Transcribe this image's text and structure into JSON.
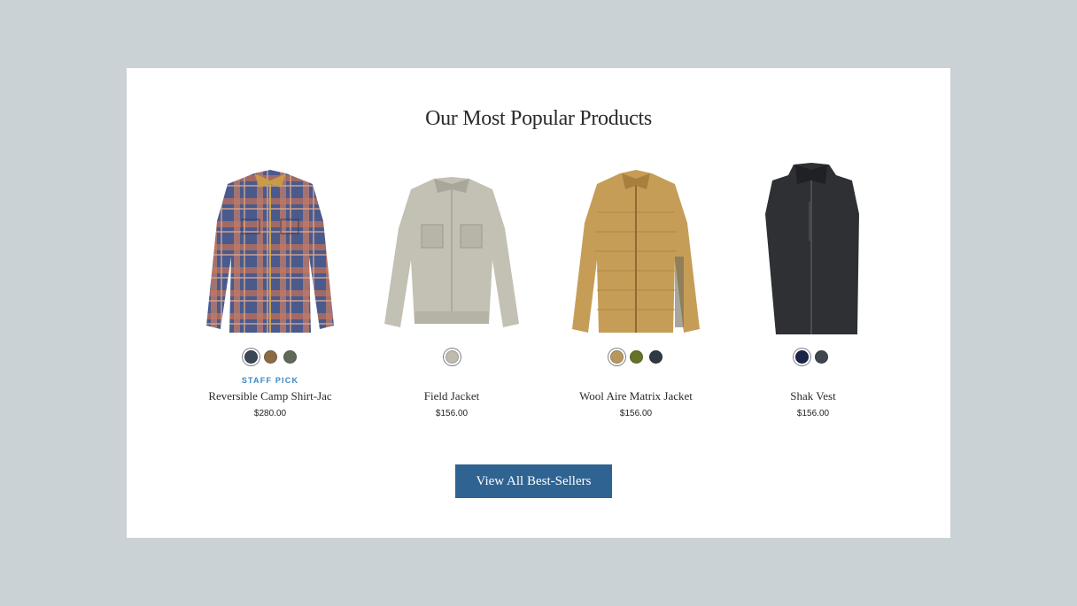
{
  "section": {
    "title": "Our Most Popular Products",
    "cta_label": "View All Best-Sellers"
  },
  "products": [
    {
      "name": "Reversible Camp Shirt-Jac",
      "price": "$280.00",
      "badge": "STAFF PICK",
      "image_icon": "plaid-shirt-jacket-image",
      "swatches": [
        {
          "color": "#3b4656",
          "selected": true
        },
        {
          "color": "#8a6a45",
          "selected": false
        },
        {
          "color": "#5f6a5b",
          "selected": false
        }
      ]
    },
    {
      "name": "Field Jacket",
      "price": "$156.00",
      "badge": "",
      "image_icon": "field-jacket-image",
      "swatches": [
        {
          "color": "#bdbaae",
          "selected": true
        }
      ]
    },
    {
      "name": "Wool Aire Matrix Jacket",
      "price": "$156.00",
      "badge": "",
      "image_icon": "quilted-jacket-image",
      "swatches": [
        {
          "color": "#b8965e",
          "selected": true
        },
        {
          "color": "#65722a",
          "selected": false
        },
        {
          "color": "#2e3942",
          "selected": false
        }
      ]
    },
    {
      "name": "Shak Vest",
      "price": "$156.00",
      "badge": "",
      "image_icon": "vest-image",
      "swatches": [
        {
          "color": "#1c2447",
          "selected": true
        },
        {
          "color": "#40464d",
          "selected": false
        }
      ]
    }
  ],
  "colors": {
    "page_bg": "#cbd2d6",
    "card_bg": "#ffffff",
    "button_bg": "#2f6392",
    "badge": "#3a87c6"
  }
}
